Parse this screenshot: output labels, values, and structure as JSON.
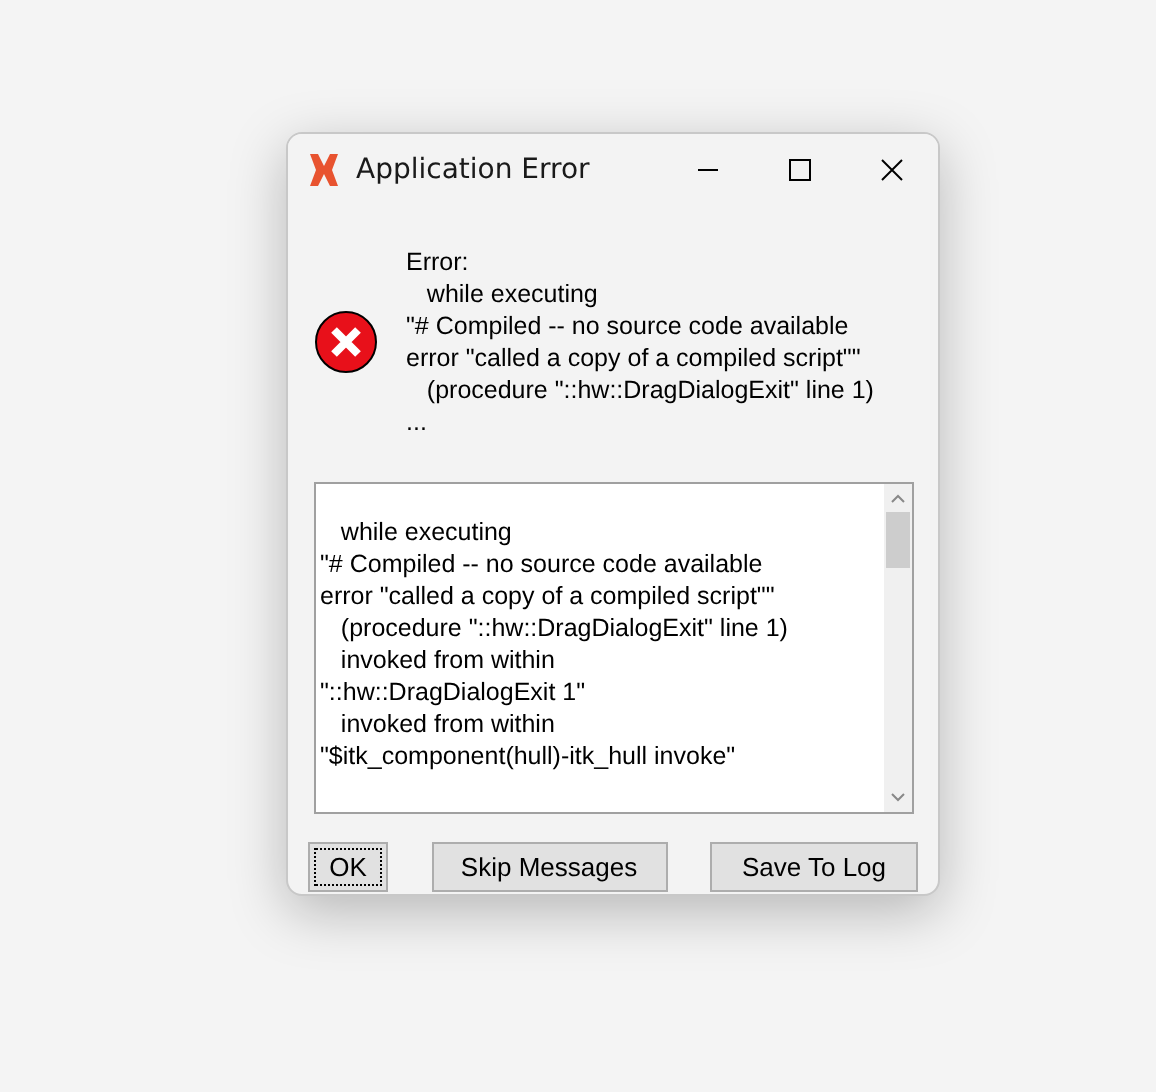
{
  "window": {
    "title": "Application Error"
  },
  "message": [
    "Error:",
    "   while executing",
    "\"# Compiled -- no source code available",
    "error \"called a copy of a compiled script\"\"",
    "   (procedure \"::hw::DragDialogExit\" line 1)",
    "..."
  ],
  "details": [
    "   while executing",
    "\"# Compiled -- no source code available",
    "error \"called a copy of a compiled script\"\"",
    "   (procedure \"::hw::DragDialogExit\" line 1)",
    "   invoked from within",
    "\"::hw::DragDialogExit 1\"",
    "   invoked from within",
    "\"$itk_component(hull)-itk_hull invoke\""
  ],
  "buttons": [
    {
      "label": "OK",
      "focused": true
    },
    {
      "label": "Skip Messages",
      "focused": false
    },
    {
      "label": "Save To Log",
      "focused": false
    }
  ]
}
